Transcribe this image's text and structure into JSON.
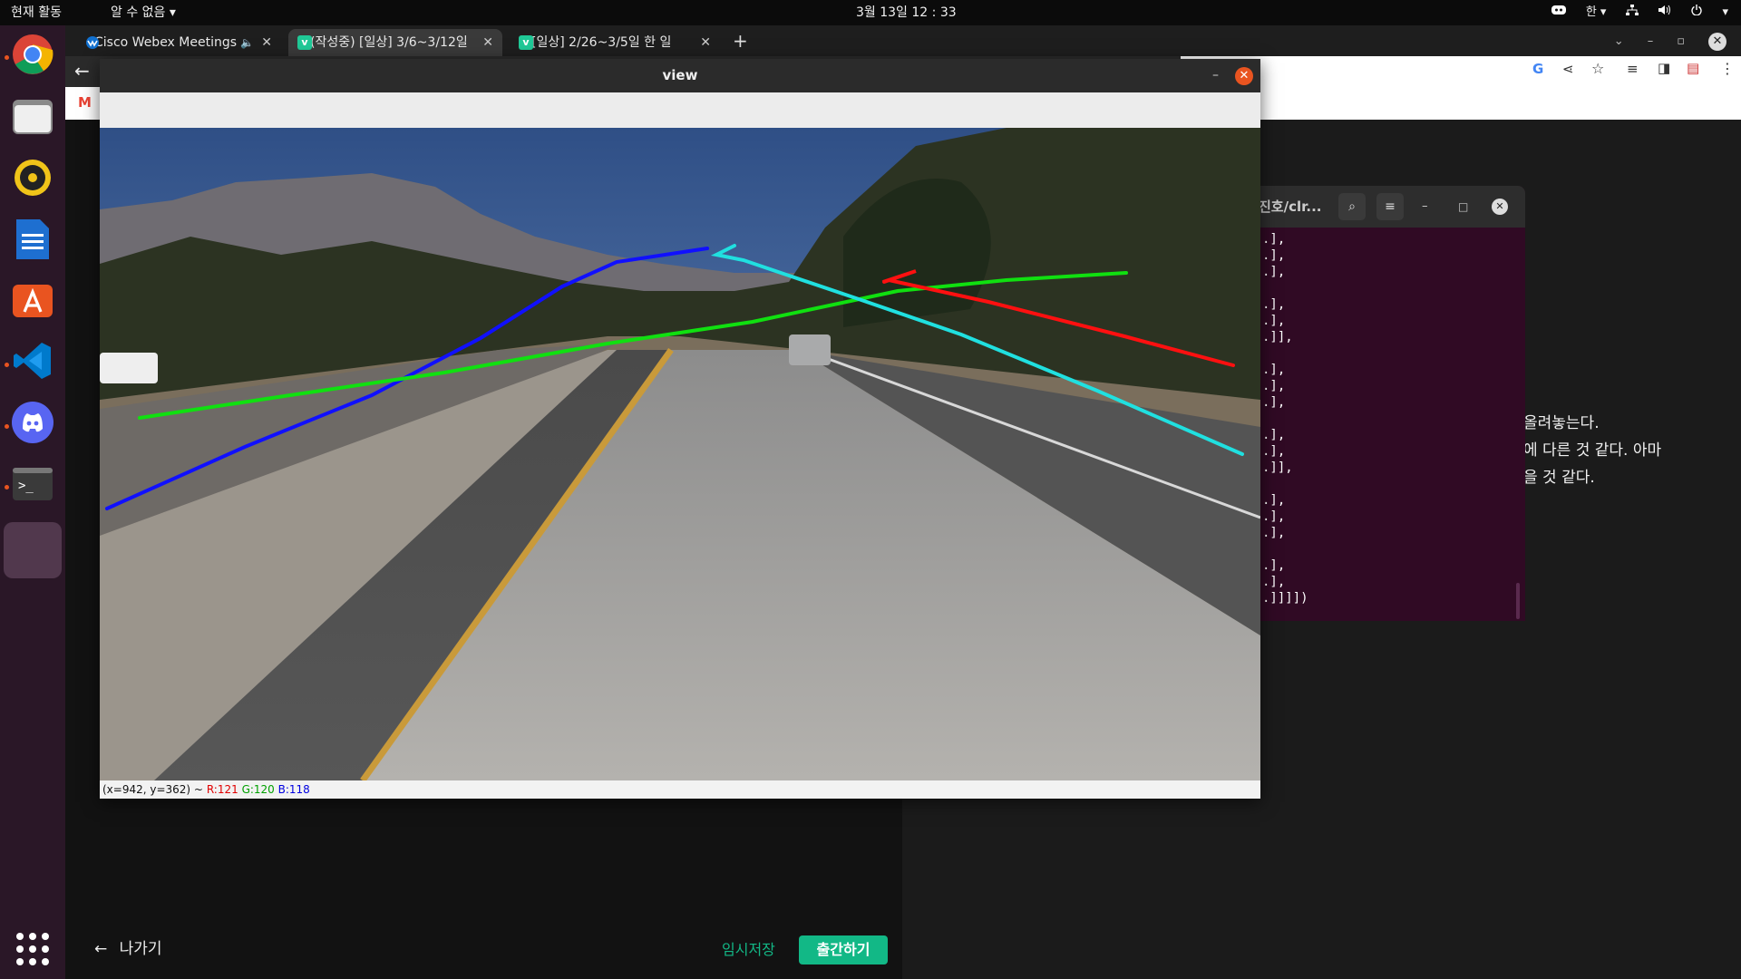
{
  "topbar": {
    "activities": "현재 활동",
    "no_window": "알 수 없음",
    "clock": "3월 13일  12 : 33",
    "input_method": "한"
  },
  "chrome": {
    "tabs": [
      {
        "title": "Cisco Webex Meetings"
      },
      {
        "title": "(작성중) [일상] 3/6~3/12일"
      },
      {
        "title": "[일상] 2/26~3/5일 한 일"
      }
    ],
    "new_tab": "+",
    "bookmark_gmail": "M"
  },
  "editor": {
    "lines": [
      "올려놓는다.",
      "에 다른 것 같다. 아마",
      "을 것 같다."
    ],
    "exit_label": "나가기",
    "draft_label": "임시저장",
    "publish_label": "출간하기"
  },
  "terminal": {
    "title": "진호/clr...",
    "lines": [
      ".],",
      ".],",
      ".],",
      "",
      ".],",
      ".],",
      ".]],",
      "",
      ".],",
      ".],",
      ".],",
      "",
      ".],",
      ".],",
      ".]],",
      "",
      ".],",
      ".],",
      ".],",
      "",
      ".],",
      ".],",
      ".]]]])"
    ]
  },
  "view": {
    "title": "view",
    "status": {
      "coords": "(x=942, y=362) ~",
      "r": "R:121",
      "g": "G:120",
      "b": "B:118"
    },
    "lane_colors": {
      "blue": "#1010ff",
      "green": "#10e010",
      "red": "#ff1010",
      "cyan": "#20e0e0"
    }
  },
  "colors": {
    "accent_green": "#12b886",
    "ubuntu_orange": "#e95420",
    "terminal_bg": "#300a24",
    "dock_bg": "#2a1727"
  }
}
